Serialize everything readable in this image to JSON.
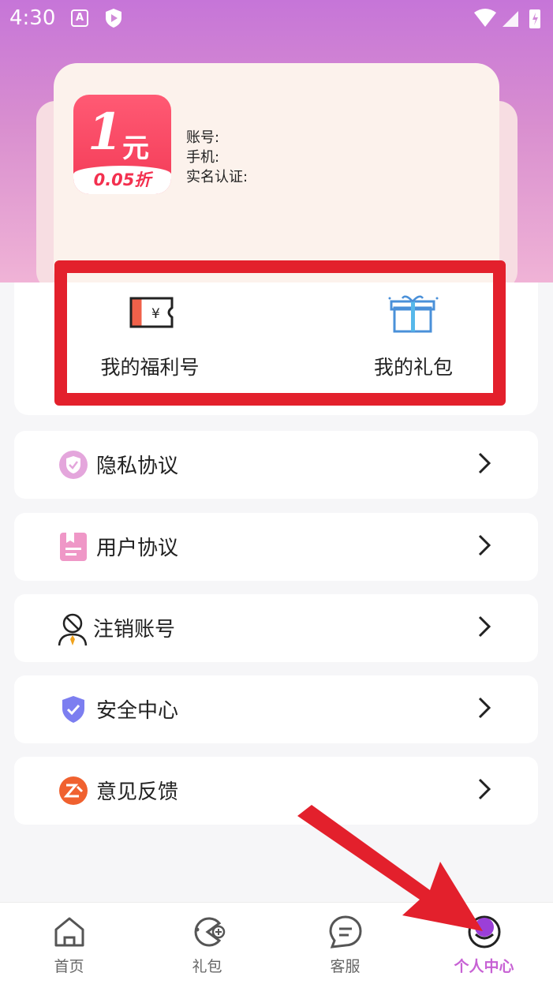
{
  "status_bar": {
    "time": "4:30",
    "a_badge": "A"
  },
  "profile": {
    "logo": {
      "big_number": "1",
      "yuan": "元",
      "discount": "0.05折"
    },
    "account_label": "账号:",
    "phone_label": "手机:",
    "realname_label": "实名认证:"
  },
  "quick_actions": [
    {
      "label": "我的福利号",
      "icon": "welfare-ticket-icon"
    },
    {
      "label": "我的礼包",
      "icon": "gift-box-icon"
    }
  ],
  "menu": [
    {
      "label": "隐私协议",
      "icon": "privacy-shield-icon"
    },
    {
      "label": "用户协议",
      "icon": "user-agreement-icon"
    },
    {
      "label": "注销账号",
      "icon": "cancel-account-icon"
    },
    {
      "label": "安全中心",
      "icon": "security-shield-icon"
    },
    {
      "label": "意见反馈",
      "icon": "feedback-icon"
    }
  ],
  "bottom_nav": [
    {
      "label": "首页",
      "icon": "home-icon",
      "active": false
    },
    {
      "label": "礼包",
      "icon": "gift-pacman-icon",
      "active": false
    },
    {
      "label": "客服",
      "icon": "chat-bubble-icon",
      "active": false
    },
    {
      "label": "个人中心",
      "icon": "profile-smile-icon",
      "active": true
    }
  ],
  "colors": {
    "accent": "#c761d4",
    "highlight": "#e3202c",
    "header_top": "#c675d8"
  }
}
